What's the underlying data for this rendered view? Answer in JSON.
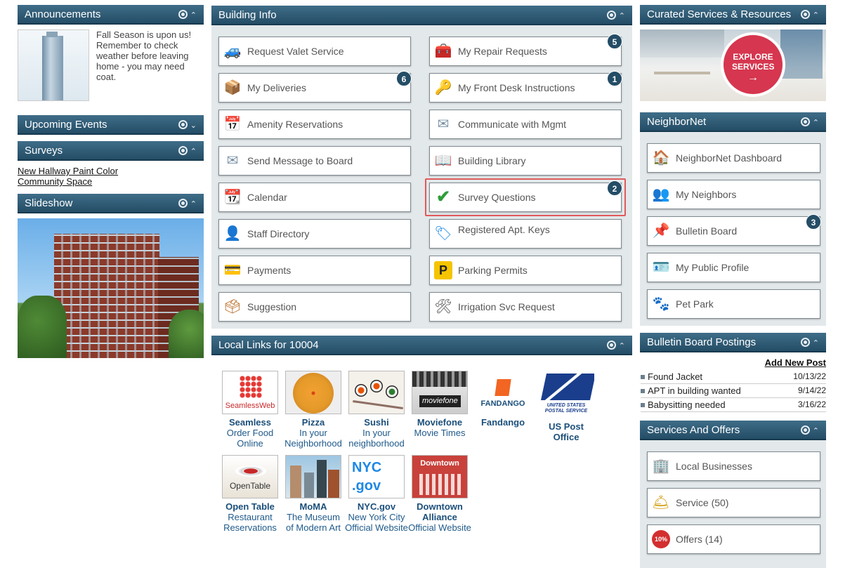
{
  "announcements": {
    "title": "Announcements",
    "text": "Fall Season is upon us! Remember to check weather before leaving home - you may need coat."
  },
  "upcoming_events": {
    "title": "Upcoming Events"
  },
  "surveys": {
    "title": "Surveys",
    "links": [
      "New Hallway Paint Color",
      "Community Space"
    ]
  },
  "slideshow": {
    "title": "Slideshow"
  },
  "building_info": {
    "title": "Building Info",
    "tiles": [
      {
        "label": "Request Valet Service",
        "icon": "car-icon"
      },
      {
        "label": "My Repair Requests",
        "icon": "toolbox-icon",
        "badge": "5"
      },
      {
        "label": "My Deliveries",
        "icon": "package-icon",
        "badge": "6"
      },
      {
        "label": "My Front Desk Instructions",
        "icon": "key-icon",
        "badge": "1"
      },
      {
        "label": "Amenity Reservations",
        "icon": "calendar-grid-icon"
      },
      {
        "label": "Communicate with Mgmt",
        "icon": "envelope-icon"
      },
      {
        "label": "Send Message to Board",
        "icon": "envelope-icon"
      },
      {
        "label": "Building Library",
        "icon": "book-icon"
      },
      {
        "label": "Calendar",
        "icon": "calendar-icon"
      },
      {
        "label": "Survey Questions",
        "icon": "checkmark-icon",
        "badge": "2"
      },
      {
        "label": "Staff Directory",
        "icon": "person-icon"
      },
      {
        "label": "Registered Apt. Keys",
        "icon": "key-tag-icon"
      },
      {
        "label": "Payments",
        "icon": "credit-card-icon"
      },
      {
        "label": "Parking Permits",
        "icon": "parking-icon"
      },
      {
        "label": "Suggestion",
        "icon": "suggestion-box-icon"
      },
      {
        "label": "Irrigation Svc Request",
        "icon": "tools-icon"
      }
    ]
  },
  "local_links": {
    "title": "Local Links for 10004",
    "items": [
      {
        "title": "Seamless",
        "sub": "Order Food Online",
        "logo": "SeamlessWeb"
      },
      {
        "title": "Pizza",
        "sub": "In your Neighborhood"
      },
      {
        "title": "Sushi",
        "sub": "In your neighborhood"
      },
      {
        "title": "Moviefone",
        "sub": "Movie Times",
        "logo": "moviefone"
      },
      {
        "title": "Fandango",
        "sub": "",
        "logo": "FANDANGO"
      },
      {
        "title": "US Post Office",
        "sub": "",
        "logo": "UNITED STATES POSTAL SERVICE"
      },
      {
        "title": "Open Table",
        "sub": "Restaurant Reservations",
        "logo": "OpenTable"
      },
      {
        "title": "MoMA",
        "sub": "The Museum of Modern Art"
      },
      {
        "title": "NYC.gov",
        "sub": "New York City Official Website",
        "logo": "NYC .gov"
      },
      {
        "title": "Downtown Alliance",
        "sub": "Official Website",
        "logo": "Downtown"
      }
    ]
  },
  "curated": {
    "title": "Curated Services & Resources",
    "explore": "EXPLORE SERVICES",
    "arrow": "→"
  },
  "neighbornet": {
    "title": "NeighborNet",
    "tiles": [
      {
        "label": "NeighborNet Dashboard",
        "icon": "house-icon"
      },
      {
        "label": "My Neighbors",
        "icon": "people-icon"
      },
      {
        "label": "Bulletin Board",
        "icon": "pushpin-icon",
        "badge": "3"
      },
      {
        "label": "My Public Profile",
        "icon": "id-card-icon"
      },
      {
        "label": "Pet Park",
        "icon": "paw-icon"
      }
    ]
  },
  "bulletin": {
    "title": "Bulletin Board Postings",
    "add_new": "Add New Post",
    "posts": [
      {
        "title": "Found Jacket",
        "date": "10/13/22"
      },
      {
        "title": "APT in building wanted",
        "date": "9/14/22"
      },
      {
        "title": "Babysitting needed",
        "date": "3/16/22"
      }
    ]
  },
  "services": {
    "title": "Services And Offers",
    "tiles": [
      {
        "label": "Local Businesses",
        "icon": "building-icon"
      },
      {
        "label": "Service (50)",
        "icon": "service-bell-icon"
      },
      {
        "label": "Offers (14)",
        "icon": "discount-icon",
        "tag": "10%"
      }
    ]
  },
  "colors": {
    "header": "#2f5a73",
    "panel_bg": "#e3e8ea",
    "badge": "#244d66",
    "highlight": "#e05a5a",
    "explore": "#d6364f"
  }
}
